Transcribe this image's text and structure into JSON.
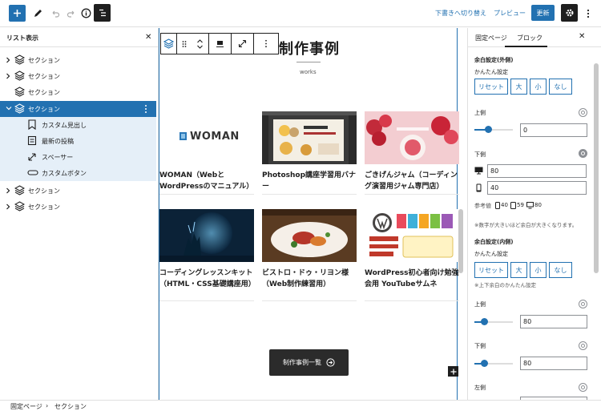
{
  "toolbar": {
    "draft_label": "下書きへ切り替え",
    "preview_label": "プレビュー",
    "update_label": "更新",
    "colors": {
      "accent": "#2271b1",
      "dark": "#1e1e1e"
    }
  },
  "listview": {
    "title": "リスト表示",
    "items": [
      {
        "label": "セクション"
      },
      {
        "label": "セクション"
      },
      {
        "label": "セクション"
      },
      {
        "label": "セクション"
      },
      {
        "label": "カスタム見出し"
      },
      {
        "label": "最新の投稿"
      },
      {
        "label": "スペーサー"
      },
      {
        "label": "カスタムボタン"
      },
      {
        "label": "セクション"
      },
      {
        "label": "セクション"
      }
    ]
  },
  "canvas": {
    "title": "制作事例",
    "subtitle": "works",
    "logo_text": "WOMAN",
    "cards": [
      {
        "title": "WOMAN（Webと WordPressのマニュアル）"
      },
      {
        "title": "Photoshop講座学習用バナー"
      },
      {
        "title": "ごきげんジャム（コーディング演習用ジャム専門店）"
      },
      {
        "title": "コーディングレッスンキット（HTML・CSS基礎講座用）"
      },
      {
        "title": "ビストロ・ドゥ・リヨン様（Web制作練習用）"
      },
      {
        "title": "WordPress初心者向け勉強会用 YouTubeサムネ"
      }
    ],
    "more_button": "制作事例一覧"
  },
  "sidebar": {
    "tabs": [
      "固定ページ",
      "ブロック"
    ],
    "margin_outer": {
      "heading": "余白設定(外側)",
      "easy_label": "かんたん設定",
      "buttons": [
        "リセット",
        "大",
        "小",
        "なし"
      ],
      "top_label": "上側",
      "top_value": "0",
      "top_slider": 0.35,
      "bottom_label": "下側",
      "bottom_pc_value": "80",
      "bottom_sp_value": "40",
      "ref_label": "参考値",
      "ref_values": [
        "40",
        "59",
        "80"
      ],
      "note": "※数字が大きいほど余白が大きくなります。"
    },
    "margin_inner": {
      "heading": "余白設定(内側)",
      "easy_label": "かんたん設定",
      "buttons": [
        "リセット",
        "大",
        "小",
        "なし"
      ],
      "note": "※上下余白のかんたん設定",
      "top_label": "上側",
      "top_value": "80",
      "top_slider": 0.25,
      "bottom_label": "下側",
      "bottom_value": "80",
      "bottom_slider": 0.25,
      "left_label": "左側"
    }
  },
  "footer": {
    "breadcrumb": [
      "固定ページ",
      "セクション"
    ]
  }
}
